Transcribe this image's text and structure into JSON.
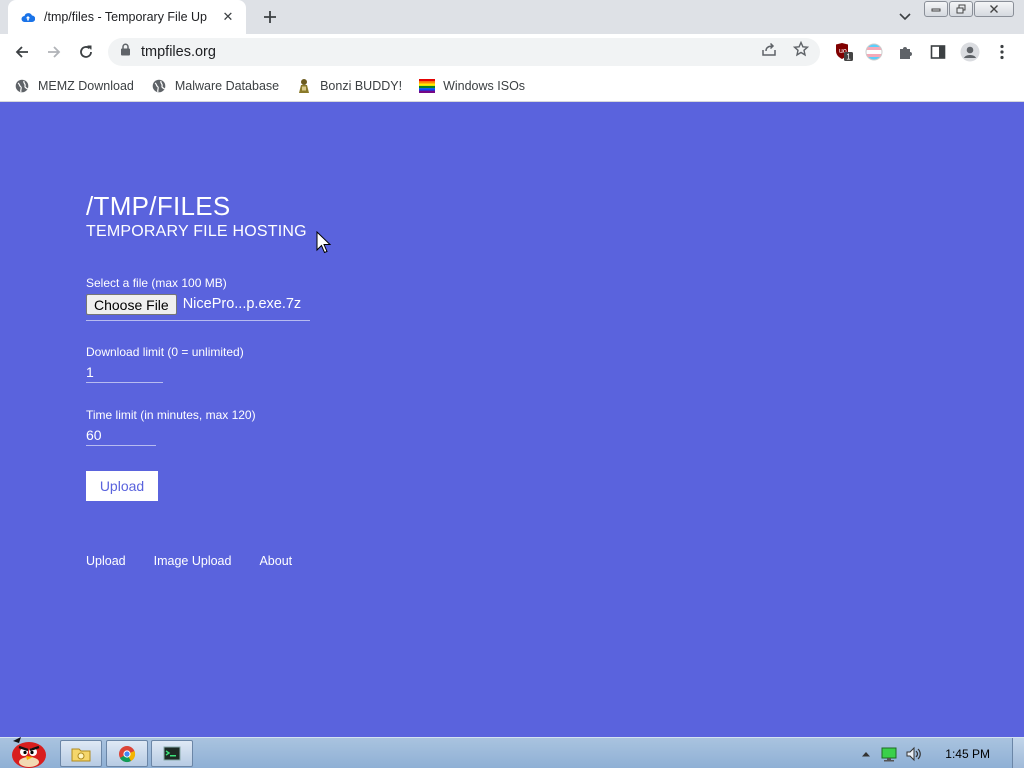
{
  "browser": {
    "tab": {
      "title": "/tmp/files - Temporary File Up"
    },
    "omnibox": {
      "url": "tmpfiles.org"
    },
    "extension_badge": "1",
    "bookmarks": [
      {
        "label": "MEMZ Download",
        "icon": "globe-icon"
      },
      {
        "label": "Malware Database",
        "icon": "globe-icon"
      },
      {
        "label": "Bonzi BUDDY!",
        "icon": "bonzi-icon"
      },
      {
        "label": "Windows ISOs",
        "icon": "rainbow-flag-icon"
      }
    ]
  },
  "page": {
    "title": "/TMP/FILES",
    "subtitle": "TEMPORARY FILE HOSTING",
    "file_field": {
      "label": "Select a file (max 100 MB)",
      "button": "Choose File",
      "selected": "NicePro...p.exe.7z"
    },
    "download_limit": {
      "label": "Download limit (0 = unlimited)",
      "value": "1"
    },
    "time_limit": {
      "label": "Time limit (in minutes, max 120)",
      "value": "60"
    },
    "upload_button": "Upload",
    "footer_links": [
      "Upload",
      "Image Upload",
      "About"
    ],
    "background_color": "#5a63dd"
  },
  "taskbar": {
    "clock": "1:45 PM",
    "start_icon": "angry-bird-icon",
    "items": [
      "explorer-icon",
      "chrome-icon",
      "terminal-icon"
    ]
  }
}
